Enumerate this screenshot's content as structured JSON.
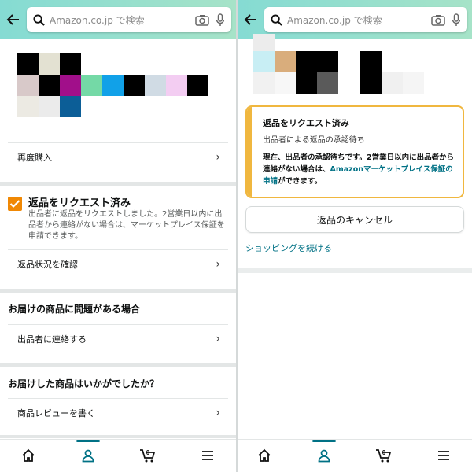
{
  "search": {
    "placeholder": "Amazon.co.jp で検索"
  },
  "left": {
    "buy_again": "再度購入",
    "return_status": {
      "title": "返品をリクエスト済み",
      "body": "出品者に返品をリクエストしました。2営業日以内に出品者から連絡がない場合は、マーケットプレイス保証を申請できます。"
    },
    "check_return": "返品状況を確認",
    "problem_section_title": "お届けの商品に問題がある場合",
    "contact_seller": "出品者に連絡する",
    "feedback_section_title": "お届けした商品はいかがでしたか？",
    "write_review": "商品レビューを書く"
  },
  "right": {
    "alert": {
      "title": "返品をリクエスト済み",
      "subtitle": "出品者による返品の承認待ち",
      "text_before": "現在、出品者の承認待ちです。2営業日以内に出品者から連絡がない場合は、",
      "link": "Amazonマーケットプレイス保証の申請",
      "text_after": "ができます。"
    },
    "cancel_button": "返品のキャンセル",
    "continue_shopping": "ショッピングを続ける"
  },
  "tabbar": {
    "cart_count": "0"
  },
  "colors": {
    "accent": "#007185",
    "warning": "#f0b73f",
    "checkbox": "#f08804",
    "header_start": "#85dbd3",
    "header_end": "#a6e3c8"
  },
  "icons": {
    "back": "arrow-left-icon",
    "search": "magnifier-icon",
    "camera": "camera-icon",
    "mic": "microphone-icon",
    "home": "home-icon",
    "account": "person-icon",
    "cart": "cart-icon",
    "menu": "hamburger-icon"
  }
}
